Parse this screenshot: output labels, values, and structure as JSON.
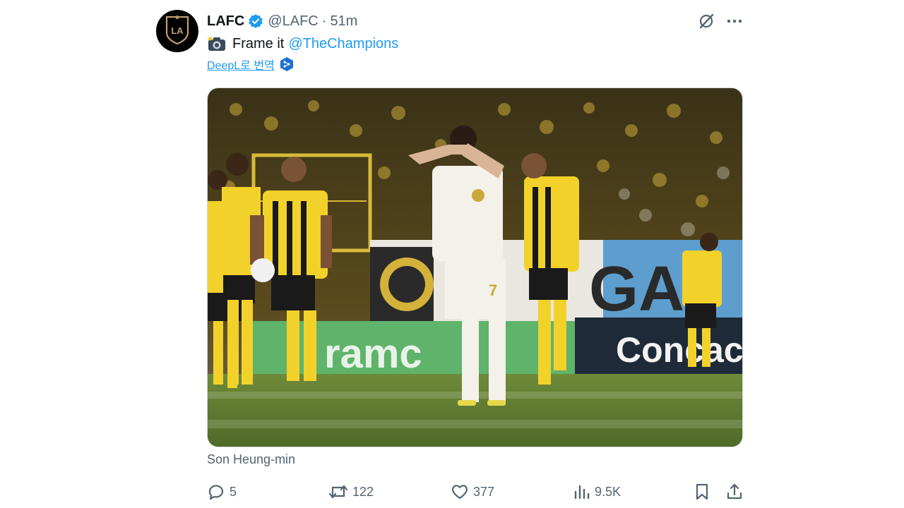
{
  "tweet": {
    "author_name": "LAFC",
    "handle": "@LAFC",
    "separator": "·",
    "time": "51m",
    "text": "Frame it",
    "mention": "@TheChampions",
    "translate_label": "DeepL로 번역",
    "media_caption": "Son Heung-min",
    "icons": {
      "avatar": "lafc-crest-icon",
      "verified": "verified-badge-icon",
      "grok": "grok-icon",
      "more": "more-icon",
      "camera": "camera-flash-icon",
      "deepl": "deepl-icon"
    }
  },
  "media": {
    "board_text_1": "ramc",
    "board_text_2": "Concac",
    "board_text_3": "GA",
    "player_number": "7"
  },
  "actions": {
    "replies": "5",
    "reposts": "122",
    "likes": "377",
    "views": "9.5K"
  },
  "colors": {
    "accent": "#1d9bf0",
    "secondary_text": "#536471",
    "primary_text": "#0f1419",
    "jersey_yellow": "#f2d22a",
    "pitch_green": "#5b7a2f"
  }
}
